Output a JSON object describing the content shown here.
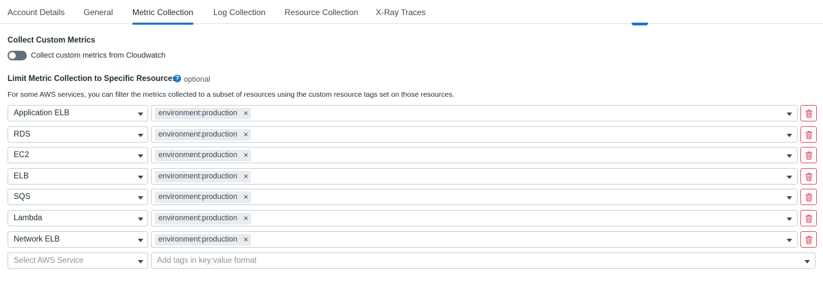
{
  "tabs": [
    {
      "label": "Account Details",
      "active": false
    },
    {
      "label": "General",
      "active": false
    },
    {
      "label": "Metric Collection",
      "active": true
    },
    {
      "label": "Log Collection",
      "active": false
    },
    {
      "label": "Resource Collection",
      "active": false
    },
    {
      "label": "X-Ray Traces",
      "active": false
    }
  ],
  "custom_metrics": {
    "title": "Collect Custom Metrics",
    "toggle_label": "Collect custom metrics from Cloudwatch",
    "toggle_on": false
  },
  "limit_collection": {
    "title": "Limit Metric Collection to Specific Resources",
    "help_icon": "question-circle-icon",
    "optional_label": "optional",
    "description": "For some AWS services, you can filter the metrics collected to a subset of resources using the custom resource tags set on those resources."
  },
  "filters": [
    {
      "service": "Application ELB",
      "tag": "environment:production"
    },
    {
      "service": "RDS",
      "tag": "environment:production"
    },
    {
      "service": "EC2",
      "tag": "environment:production"
    },
    {
      "service": "ELB",
      "tag": "environment:production"
    },
    {
      "service": "SQS",
      "tag": "environment:production"
    },
    {
      "service": "Lambda",
      "tag": "environment:production"
    },
    {
      "service": "Network ELB",
      "tag": "environment:production"
    }
  ],
  "new_filter": {
    "service_placeholder": "Select AWS Service",
    "tags_placeholder": "Add tags in key:value format"
  },
  "chip_remove_glyph": "×",
  "colors": {
    "accent": "#2173c9",
    "danger": "#e0556b",
    "toggle_off": "#616e77"
  }
}
